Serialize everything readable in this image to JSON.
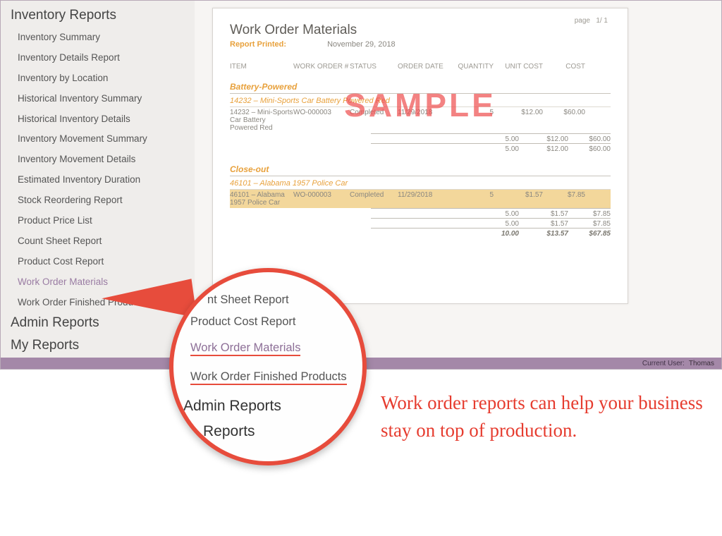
{
  "sidebar": {
    "sections": {
      "inventory": {
        "title": "Inventory Reports",
        "items": [
          "Inventory Summary",
          "Inventory Details Report",
          "Inventory by Location",
          "Historical Inventory Summary",
          "Historical Inventory Details",
          "Inventory Movement Summary",
          "Inventory Movement Details",
          "Estimated Inventory Duration",
          "Stock Reordering Report",
          "Product Price List",
          "Count Sheet Report",
          "Product Cost Report",
          "Work Order Materials",
          "Work Order Finished Products"
        ],
        "active_index": 12
      },
      "admin": {
        "title": "Admin Reports"
      },
      "my": {
        "title": "My Reports"
      }
    }
  },
  "report": {
    "page_label": "page",
    "page_value": "1/ 1",
    "title": "Work Order Materials",
    "printed_label": "Report Printed:",
    "printed_date": "November 29, 2018",
    "watermark": "SAMPLE",
    "columns": {
      "item": "ITEM",
      "wo": "WORK ORDER #",
      "status": "STATUS",
      "date": "ORDER DATE",
      "qty": "QUANTITY",
      "unit": "UNIT COST",
      "cost": "COST"
    },
    "groups": [
      {
        "name": "Battery-Powered",
        "sub": "14232 – Mini-Sports Car Battery Powered Red",
        "rows": [
          {
            "item": "14232 – Mini-Sports Car Battery Powered Red",
            "wo": "WO-000003",
            "status": "Completed",
            "date": "11/29/2018",
            "qty": "5",
            "unit": "$12.00",
            "cost": "$60.00",
            "hl": false
          }
        ],
        "totals": [
          {
            "qty": "5.00",
            "unit": "$12.00",
            "cost": "$60.00"
          },
          {
            "qty": "5.00",
            "unit": "$12.00",
            "cost": "$60.00"
          }
        ]
      },
      {
        "name": "Close-out",
        "sub": "46101 – Alabama 1957 Police Car",
        "rows": [
          {
            "item": "46101 – Alabama 1957 Police Car",
            "wo": "WO-000003",
            "status": "Completed",
            "date": "11/29/2018",
            "qty": "5",
            "unit": "$1.57",
            "cost": "$7.85",
            "hl": true
          }
        ],
        "totals": [
          {
            "qty": "5.00",
            "unit": "$1.57",
            "cost": "$7.85"
          },
          {
            "qty": "5.00",
            "unit": "$1.57",
            "cost": "$7.85"
          }
        ]
      }
    ],
    "grand": {
      "qty": "10.00",
      "unit": "$13.57",
      "cost": "$67.85"
    }
  },
  "status": {
    "label": "Current User:",
    "user": "Thomas"
  },
  "lens": {
    "items": [
      {
        "text": "nt Sheet Report",
        "style": "plain",
        "pad": true
      },
      {
        "text": "Product Cost Report",
        "style": "plain"
      },
      {
        "text": "Work Order Materials",
        "style": "underlined-active"
      },
      {
        "text": "Work Order Finished Products",
        "style": "underlined"
      }
    ],
    "heads": [
      "Admin Reports",
      "Reports"
    ]
  },
  "annotation": "Work order reports can help your business stay on top of production."
}
